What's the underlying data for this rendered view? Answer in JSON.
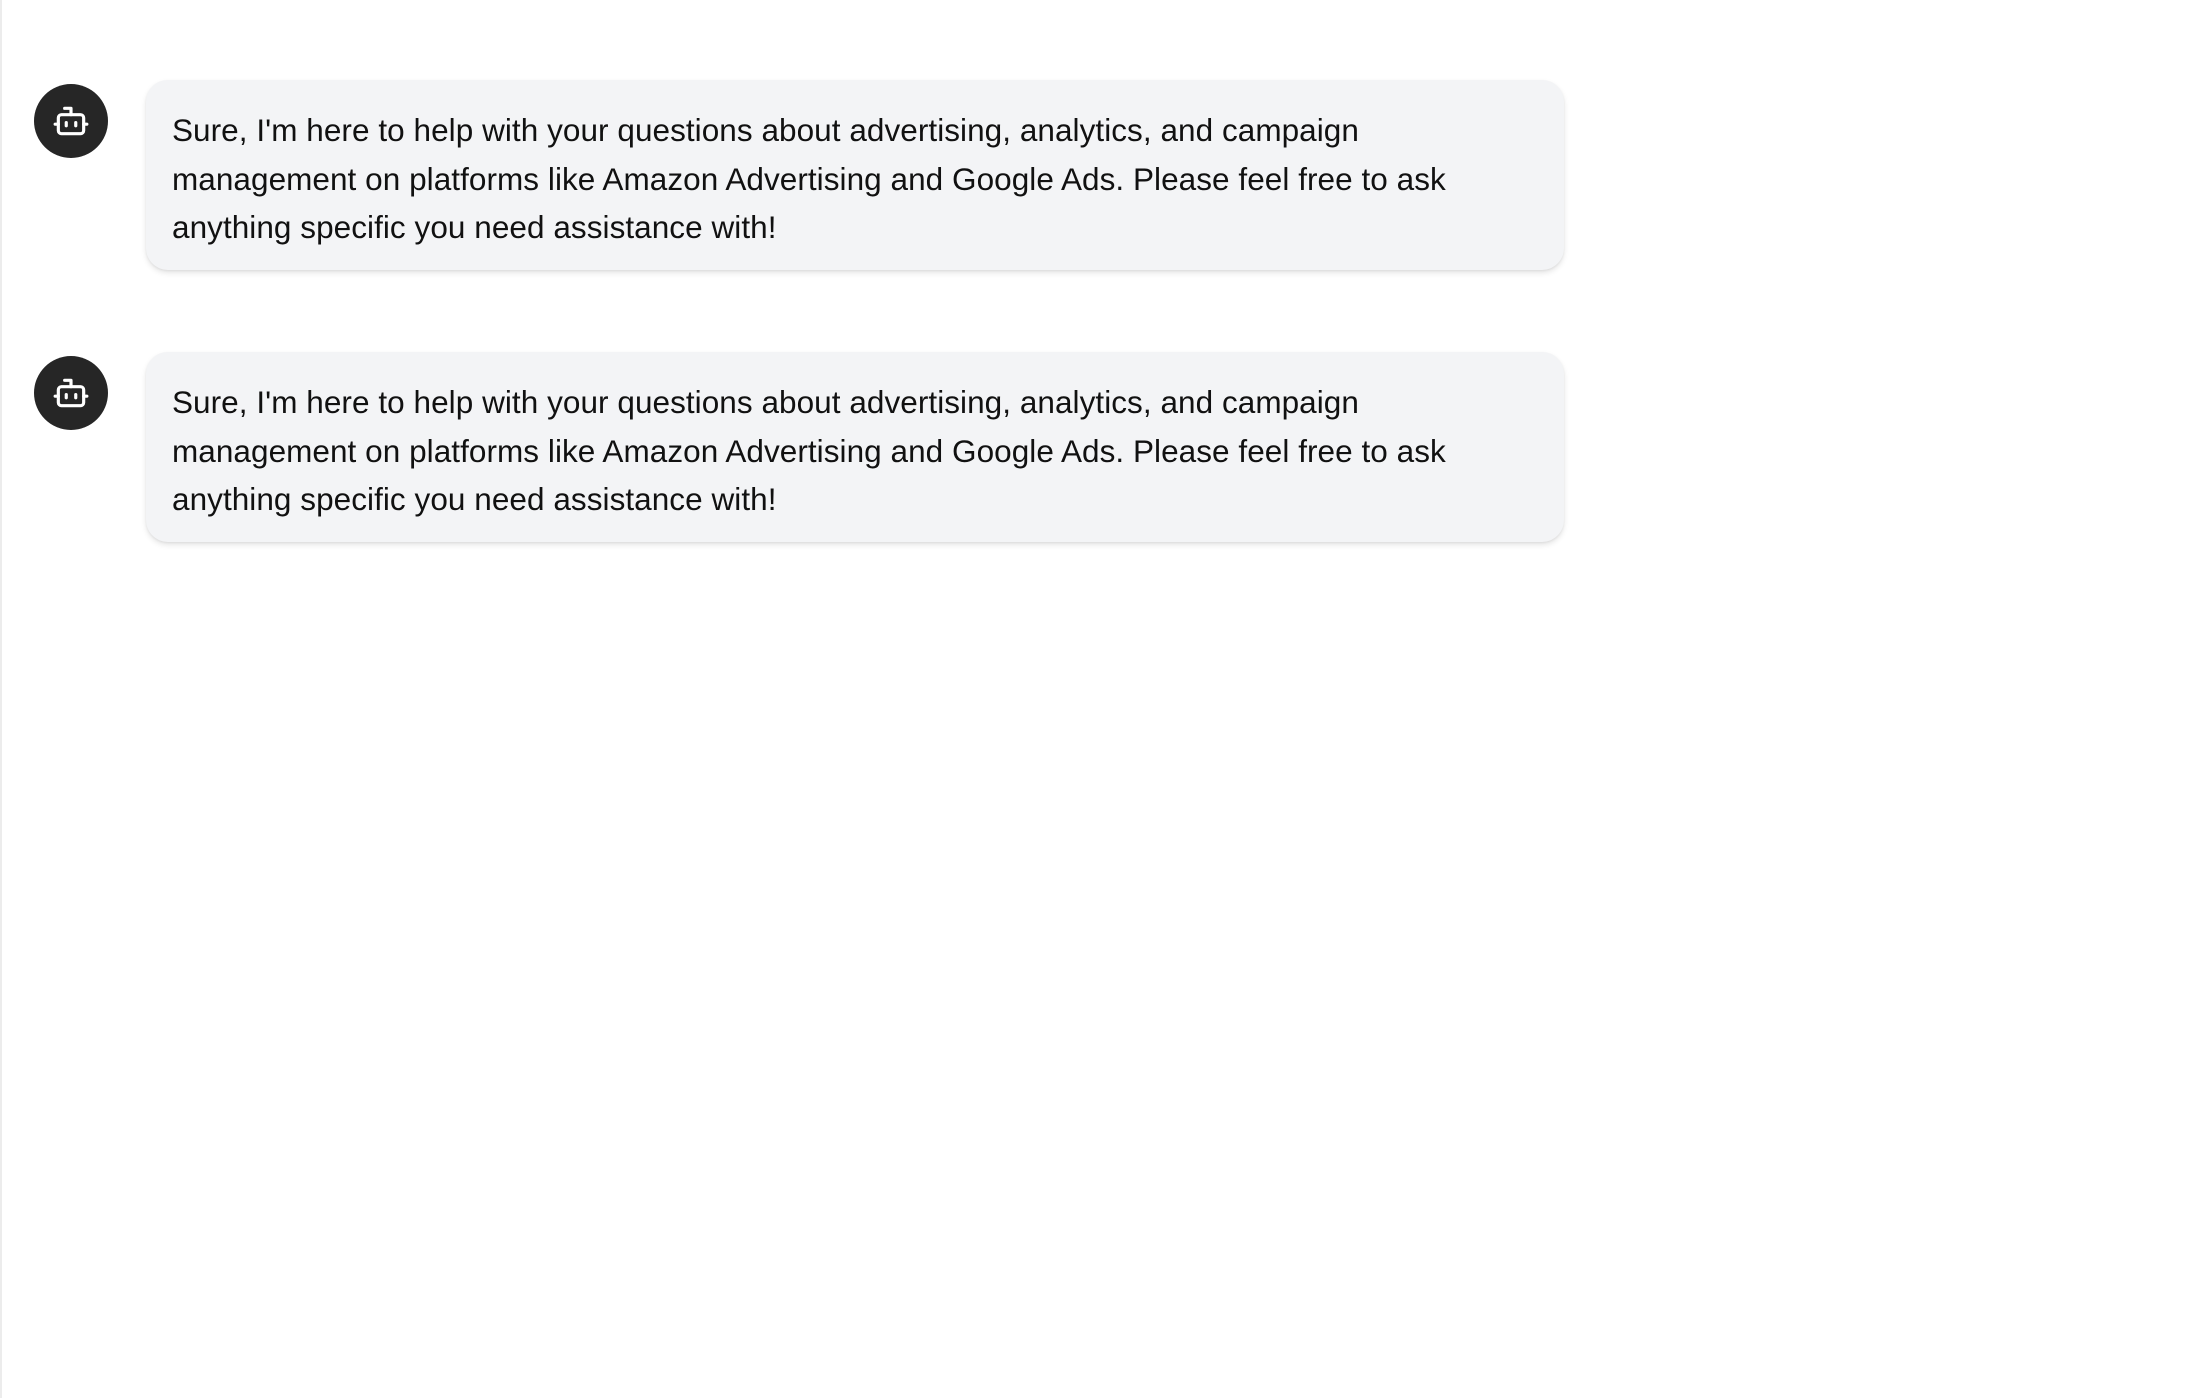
{
  "chat": {
    "messages": [
      {
        "role": "assistant",
        "avatar_icon": "robot-icon",
        "text": "Sure, I'm here to help with your questions about advertising, analytics, and campaign management on platforms like Amazon Advertising and Google Ads. Please feel free to ask anything specific you need assistance with!"
      },
      {
        "role": "assistant",
        "avatar_icon": "robot-icon",
        "text": "Sure, I'm here to help with your questions about advertising, analytics, and campaign management on platforms like Amazon Advertising and Google Ads. Please feel free to ask anything specific you need assistance with!"
      }
    ]
  },
  "colors": {
    "avatar_bg": "#262626",
    "bubble_bg": "#f3f4f6",
    "text": "#111111"
  }
}
